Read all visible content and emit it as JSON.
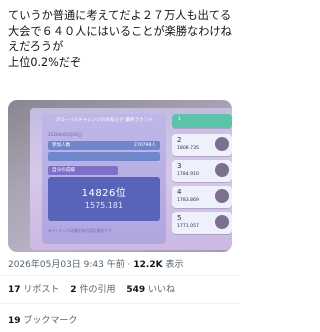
{
  "post": {
    "text": "ていうか普通に考えてだよ２７万人も出てる大会で６４０人にはいることが楽勝なわけねえだろうが\n上位0.2%だぞ"
  },
  "photo": {
    "panel_header": "グローバルチャレンジのお知らせ 最終ラウンド",
    "panel_date": "2026年05月03日",
    "rows": [
      {
        "label": "参加人数",
        "value": "276798人"
      },
      {
        "label": "",
        "value": ""
      }
    ],
    "result_label": "自分の成績",
    "my_rank": "14826位",
    "my_score": "1575.181",
    "note": "※ランキングは確定前の暫定順位です",
    "leaderboard": [
      {
        "rank": "1",
        "score": ""
      },
      {
        "rank": "2",
        "score": "1808.735"
      },
      {
        "rank": "3",
        "score": "1784.910"
      },
      {
        "rank": "4",
        "score": "1783.869"
      },
      {
        "rank": "5",
        "score": "1771.057"
      }
    ]
  },
  "meta": {
    "timestamp": "2026年05月03日 9:43 午前",
    "separator": "·",
    "views": "12.2K",
    "views_label": "表示"
  },
  "stats": {
    "reposts": "17",
    "reposts_label": "リポスト",
    "quotes": "2",
    "quotes_label": "件の引用",
    "likes": "549",
    "likes_label": "いいね",
    "bookmarks": "19",
    "bookmarks_label": "ブックマーク"
  }
}
